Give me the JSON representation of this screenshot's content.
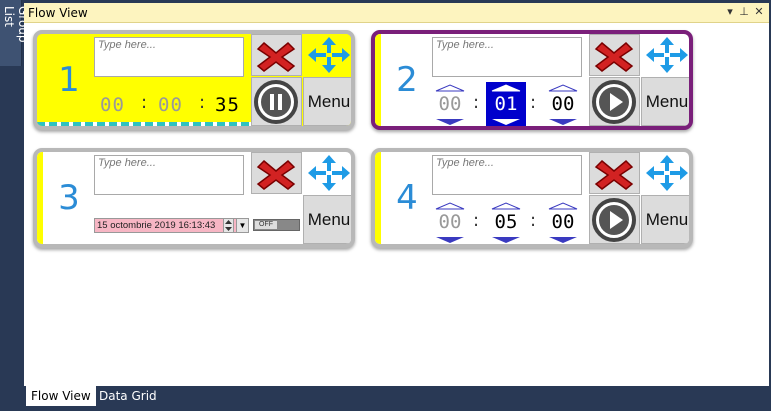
{
  "side_tab": {
    "label": "Group List"
  },
  "panel": {
    "title": "Flow View",
    "dropdown_icon": "dropdown-arrow-icon",
    "pin_icon": "pin-icon",
    "close_icon": "close-icon"
  },
  "note_placeholder": "Type here...",
  "menu_label": "Menu",
  "cards": [
    {
      "number": "1",
      "hours": "00",
      "minutes": "00",
      "seconds": "35",
      "action": "pause",
      "highlight": "yellow"
    },
    {
      "number": "2",
      "hours": "00",
      "minutes": "01",
      "seconds": "00",
      "action": "play",
      "selected": true
    },
    {
      "number": "3",
      "date": "15 octombrie 2019 16:13:43",
      "toggle": "OFF"
    },
    {
      "number": "4",
      "hours": "00",
      "minutes": "05",
      "seconds": "00",
      "action": "play"
    }
  ],
  "separator": ":",
  "bottom_tabs": [
    {
      "label": "Flow View",
      "active": true
    },
    {
      "label": "Data Grid",
      "active": false
    }
  ],
  "colors": {
    "accent": "#2b8cd6",
    "card_highlight": "#ffff00",
    "selected_border": "#7a1f7a",
    "close": "#d22222",
    "date_bg": "#f7b6c4"
  }
}
